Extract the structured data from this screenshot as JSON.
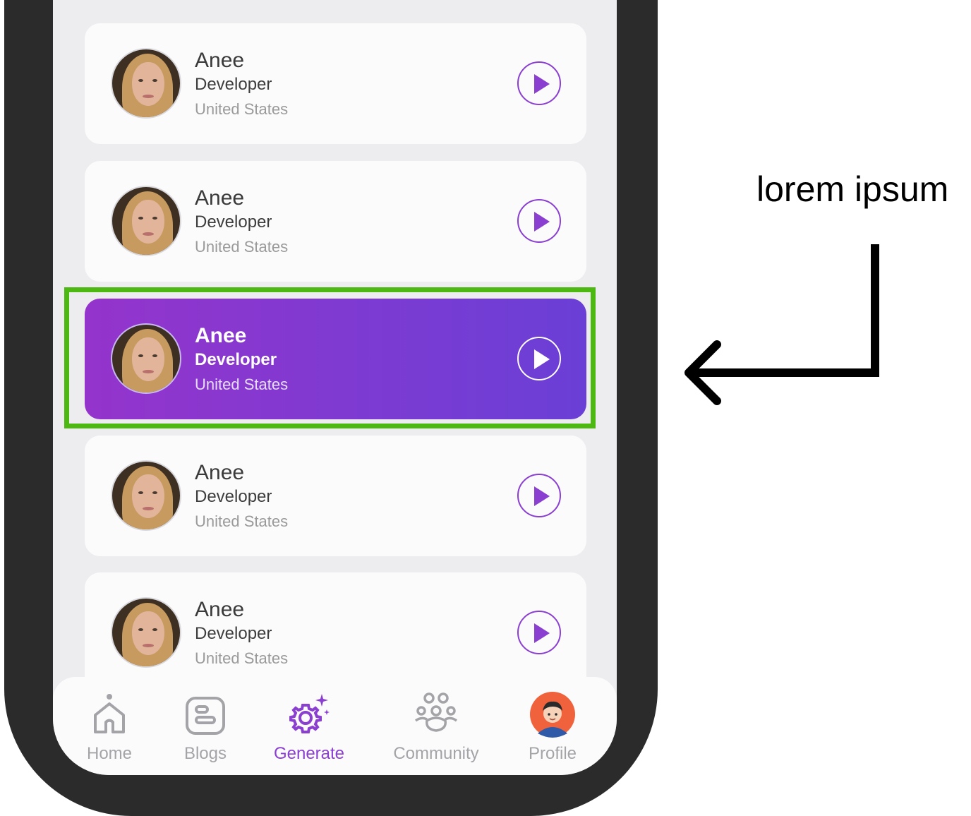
{
  "cards": [
    {
      "name": "Anee",
      "role": "Developer",
      "country": "United States",
      "active": false
    },
    {
      "name": "Anee",
      "role": "Developer",
      "country": "United States",
      "active": false
    },
    {
      "name": "Anee",
      "role": "Developer",
      "country": "United States",
      "active": true
    },
    {
      "name": "Anee",
      "role": "Developer",
      "country": "United States",
      "active": false
    },
    {
      "name": "Anee",
      "role": "Developer",
      "country": "United States",
      "active": false
    }
  ],
  "nav": {
    "items": [
      {
        "label": "Home",
        "icon": "home-icon"
      },
      {
        "label": "Blogs",
        "icon": "blogs-icon"
      },
      {
        "label": "Generate",
        "icon": "generate-gear-icon"
      },
      {
        "label": "Community",
        "icon": "community-icon"
      },
      {
        "label": "Profile",
        "icon": "profile-avatar-icon"
      }
    ],
    "active": "Generate"
  },
  "annotation": {
    "text": "lorem ipsum"
  },
  "colors": {
    "accent": "#8a3fd0",
    "highlight": "#4db812",
    "card_gradient_start": "#9434cc",
    "card_gradient_end": "#6a3fd6"
  }
}
